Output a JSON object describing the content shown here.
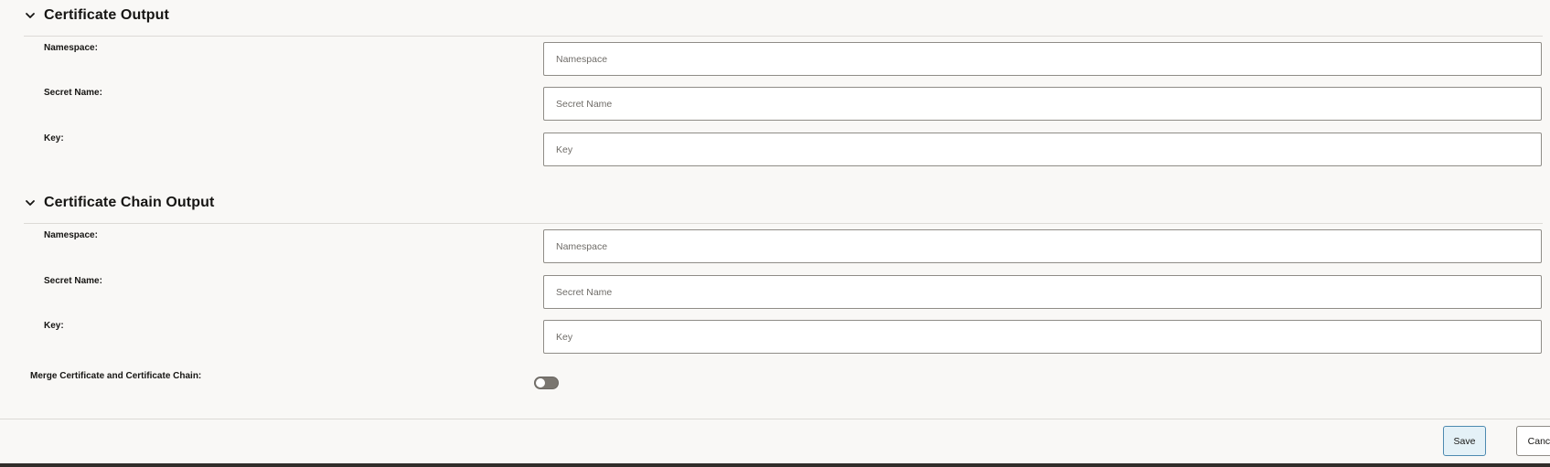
{
  "sections": [
    {
      "title": "Certificate Output",
      "fields": [
        {
          "label": "Namespace:",
          "placeholder": "Namespace",
          "value": ""
        },
        {
          "label": "Secret Name:",
          "placeholder": "Secret Name",
          "value": ""
        },
        {
          "label": "Key:",
          "placeholder": "Key",
          "value": ""
        }
      ]
    },
    {
      "title": "Certificate Chain Output",
      "fields": [
        {
          "label": "Namespace:",
          "placeholder": "Namespace",
          "value": ""
        },
        {
          "label": "Secret Name:",
          "placeholder": "Secret Name",
          "value": ""
        },
        {
          "label": "Key:",
          "placeholder": "Key",
          "value": ""
        }
      ]
    }
  ],
  "merge": {
    "label": "Merge Certificate and Certificate Chain:",
    "enabled": false
  },
  "footer": {
    "save_label": "Save",
    "cancel_label": "Cancel"
  },
  "colors": {
    "background": "#f9f8f6",
    "save_accent": "#4d8ab0"
  }
}
